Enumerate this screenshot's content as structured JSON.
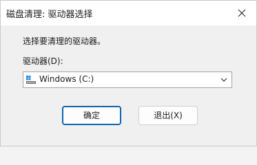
{
  "window": {
    "title": "磁盘清理: 驱动器选择"
  },
  "dialog": {
    "prompt": "选择要清理的驱动器。",
    "drive_label": "驱动器(D):",
    "selected_drive": "Windows (C:)"
  },
  "buttons": {
    "ok": "确定",
    "exit": "退出(X)"
  },
  "icons": {
    "close": "close-icon",
    "drive": "drive-icon",
    "dropdown": "chevron-down-icon"
  },
  "colors": {
    "default_button_border": "#0a64b4"
  }
}
